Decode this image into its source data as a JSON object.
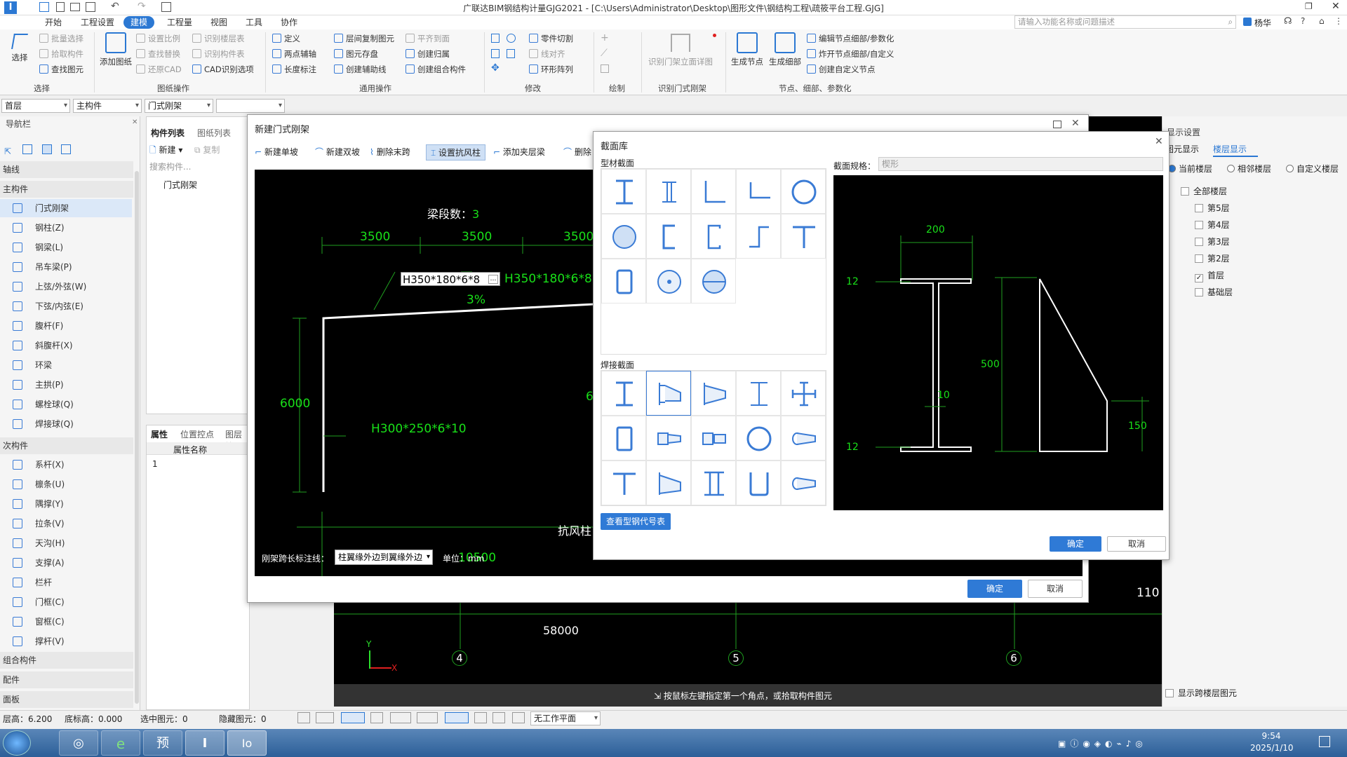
{
  "window": {
    "title": "广联达BIM钢结构计量GJG2021 - [C:\\Users\\Administrator\\Desktop\\图形文件\\钢结构工程\\疏筱平台工程.GJG]"
  },
  "menu": [
    "开始",
    "工程设置",
    "建模",
    "工程量",
    "视图",
    "工具",
    "协作"
  ],
  "search": {
    "placeholder": "请输入功能名称或问题描述"
  },
  "user": {
    "name": "杨华"
  },
  "ribbon": {
    "select": {
      "label": "选择",
      "items": [
        "批量选择",
        "拾取构件",
        "查找图元"
      ],
      "group": "选择"
    },
    "drawing": {
      "big": "添加图纸",
      "items": [
        "设置比例",
        "识别楼层表",
        "查找替换",
        "识别构件表",
        "还原CAD",
        "CAD识别选项"
      ],
      "group": "图纸操作"
    },
    "common": {
      "items": [
        "定义",
        "层间复制图元",
        "平齐到面",
        "两点辅轴",
        "图元存盘",
        "创建归属",
        "长度标注",
        "创建辅助线",
        "创建组合构件"
      ],
      "group": "通用操作"
    },
    "modify": {
      "items": [
        "零件切割",
        "线对齐",
        "环形阵列"
      ],
      "group": "修改"
    },
    "draw": {
      "group": "绘制"
    },
    "door": {
      "big": "识别门架立面详图",
      "group": "识别门式刚架"
    },
    "node": {
      "big1": "生成节点",
      "big2": "生成细部",
      "items": [
        "编辑节点细部/参数化",
        "炸开节点细部/自定义",
        "创建自定义节点"
      ],
      "group": "节点、细部、参数化"
    }
  },
  "fields": {
    "floor": "首层",
    "type": "主构件",
    "component": "门式刚架",
    "blank": ""
  },
  "nav": {
    "title": "导航栏",
    "sections": [
      "轴线",
      "主构件",
      "次构件",
      "组合构件",
      "配件",
      "面板"
    ],
    "main_items": [
      "门式刚架",
      "钢柱(Z)",
      "钢梁(L)",
      "吊车梁(P)",
      "上弦/外弦(W)",
      "下弦/内弦(E)",
      "腹杆(F)",
      "斜腹杆(X)",
      "环梁",
      "主拱(P)",
      "螺栓球(Q)",
      "焊接球(Q)"
    ],
    "sub_items": [
      "系杆(X)",
      "檩条(U)",
      "隅撑(Y)",
      "拉条(V)",
      "天沟(H)",
      "支撑(A)",
      "栏杆",
      "门框(C)",
      "窗框(C)",
      "撑杆(V)"
    ]
  },
  "complist": {
    "tabs": [
      "构件列表",
      "图纸列表"
    ],
    "new": "新建",
    "copy": "复制",
    "search": "搜索构件...",
    "item": "门式刚架"
  },
  "props": {
    "tabs": [
      "属性",
      "位置控点",
      "图层管"
    ],
    "col": "属性名称",
    "row1": "1"
  },
  "canvas": {
    "dim": "58000",
    "dim2": "110",
    "axes": [
      "4",
      "5",
      "6"
    ],
    "hint": "按鼠标左键指定第一个角点，或拾取构件图元",
    "y": "Y",
    "x": "X"
  },
  "right": {
    "title": "显示设置",
    "tabs": [
      "图元显示",
      "楼层显示"
    ],
    "radios": [
      "当前楼层",
      "相邻楼层",
      "自定义楼层"
    ],
    "floors": [
      "全部楼层",
      "第5层",
      "第4层",
      "第3层",
      "第2层",
      "首层",
      "基础层"
    ],
    "bottom": "显示跨楼层图元"
  },
  "status": {
    "floor_h": "层高：6.200",
    "base": "底标高：0.000",
    "selected": "选中图元：0",
    "hidden": "隐藏图元：0",
    "plane": "无工作平面"
  },
  "dlg1": {
    "title": "新建门式刚架",
    "tools": [
      "新建单坡",
      "新建双坡",
      "删除末跨",
      "设置抗风柱",
      "添加夹层梁",
      "删除"
    ],
    "seg_label": "梁段数：",
    "seg_value": "3",
    "spans": [
      "3500",
      "3500",
      "3500"
    ],
    "beam_input": "H350*180*6*8",
    "beam_label": "H350*180*6*8",
    "slope": "3%",
    "height": "6000",
    "column": "H300*250*6*10",
    "col2": "6",
    "wind": "抗风柱",
    "total": "10500",
    "footer_label": "刚架跨长标注线：",
    "footer_value": "柱翼缘外边到翼缘外边",
    "unit": "单位：mm",
    "ok": "确定",
    "cancel": "取消"
  },
  "dlg2": {
    "title": "截面库",
    "profile_label": "型材截面",
    "welded_label": "焊接截面",
    "spec_label": "截面规格：",
    "spec_value": "楔形",
    "table_btn": "查看型钢代号表",
    "dims": {
      "w": "200",
      "tf_top": "12",
      "tw": "10",
      "tf_bot": "12",
      "h": "500",
      "h2": "150"
    },
    "ok": "确定",
    "cancel": "取消"
  },
  "taskbar": {
    "time": "9:54",
    "date": "2025/1/10"
  }
}
